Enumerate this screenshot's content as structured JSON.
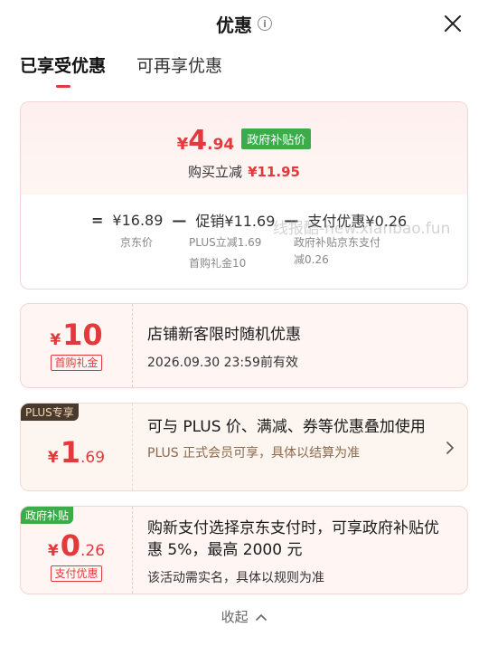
{
  "header": {
    "title": "优惠"
  },
  "tabs": [
    {
      "label": "已享受优惠"
    },
    {
      "label": "可再享优惠"
    }
  ],
  "summary": {
    "final_price": {
      "symbol": "¥",
      "int": "4",
      "dec": ".94"
    },
    "gov_tag": "政府补贴价",
    "instant_label": "购买立减",
    "instant_amount": "¥11.95",
    "formula": {
      "op_eq": "=",
      "op_minus": "—",
      "base": "¥16.89",
      "promo": "促销¥11.69",
      "pay": "支付优惠¥0.26",
      "base_label": "京东价",
      "promo_label_1": "PLUS立减1.69",
      "promo_label_2": "首购礼金10",
      "pay_label_1": "政府补贴京东支付",
      "pay_label_2": "减0.26"
    }
  },
  "watermark": "线报酷-new.xianbao.fun",
  "coupons": [
    {
      "symbol": "¥",
      "int": "10",
      "dec": "",
      "tag": "首购礼金",
      "corner": "",
      "title": "店铺新客限时随机优惠",
      "sub": "2026.09.30 23:59前有效",
      "note": ""
    },
    {
      "symbol": "¥",
      "int": "1",
      "dec": ".69",
      "tag": "",
      "corner": "PLUS专享",
      "title": "可与 PLUS 价、满减、券等优惠叠加使用",
      "sub": "",
      "note": "PLUS 正式会员可享，具体以结算为准"
    },
    {
      "symbol": "¥",
      "int": "0",
      "dec": ".26",
      "tag": "支付优惠",
      "corner": "政府补贴",
      "title": "购新支付选择京东支付时，可享政府补贴优惠 5%，最高 2000 元",
      "sub": "",
      "note": "该活动需实名，具体以规则为准"
    }
  ],
  "footer": {
    "collapse_label": "收起"
  },
  "colors": {
    "accent": "#e4393c",
    "gov_green": "#3cab4a",
    "plus_dark": "#4a3a2e"
  },
  "icons": [
    "info-icon",
    "close-icon",
    "chevron-right-icon",
    "chevron-up-icon"
  ]
}
